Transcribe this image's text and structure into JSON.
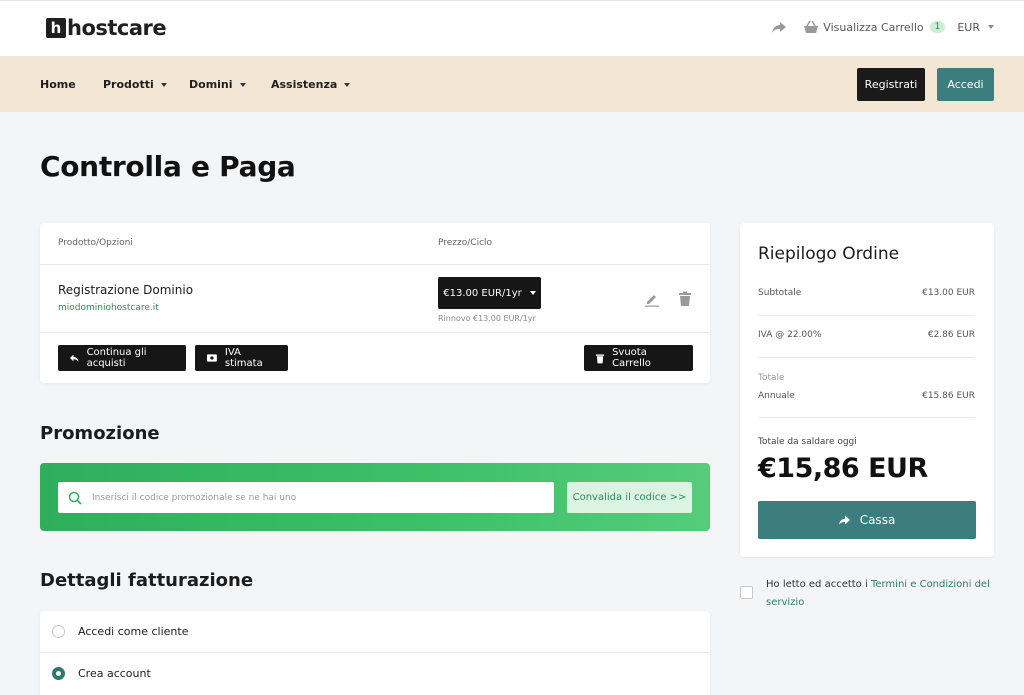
{
  "header": {
    "logo_mark": "h",
    "logo_text": "hostcare",
    "cart_label": "Visualizza Carrello",
    "cart_count": "1",
    "currency": "EUR"
  },
  "nav": {
    "items": [
      {
        "label": "Home"
      },
      {
        "label": "Prodotti"
      },
      {
        "label": "Domini"
      },
      {
        "label": "Assistenza"
      }
    ],
    "register_label": "Registrati",
    "login_label": "Accedi"
  },
  "page": {
    "title": "Controlla e Paga"
  },
  "cart": {
    "col_product": "Prodotto/Opzioni",
    "col_price": "Prezzo/Ciclo",
    "item_name": "Registrazione Dominio",
    "item_domain": "miodominiohostcare.it",
    "price": "€13.00 EUR/1yr",
    "renewal": "Rinnovo €13.00 EUR/1yr",
    "continue_label": "Continua gli acquisti",
    "tax_label": "IVA stimata",
    "empty_label": "Svuota Carrello"
  },
  "promo": {
    "title": "Promozione",
    "placeholder": "Inserisci il codice promozionale se ne hai uno",
    "button_label": "Convalida il codice >>"
  },
  "billing": {
    "title": "Dettagli fatturazione",
    "option_login": "Accedi come cliente",
    "option_create": "Crea account",
    "selected": "Crea account"
  },
  "summary": {
    "title": "Riepilogo Ordine",
    "subtotal_label": "Subtotale",
    "subtotal_value": "€13.00 EUR",
    "tax_label": "IVA @ 22.00%",
    "tax_value": "€2.86 EUR",
    "totals_label": "Totale",
    "annual_label": "Annuale",
    "annual_value": "€15.86 EUR",
    "due_label": "Totale da saldare oggi",
    "due_value": "€15,86 EUR",
    "checkout_label": "Cassa"
  },
  "terms": {
    "prefix": "Ho letto ed accetto i ",
    "link": "Termini e Condizioni del servizio"
  },
  "colors": {
    "accent_teal": "#3c7d7e",
    "promo_green": "#3cbf68",
    "nav_bg": "#f3e6d5",
    "dark": "#161616"
  }
}
